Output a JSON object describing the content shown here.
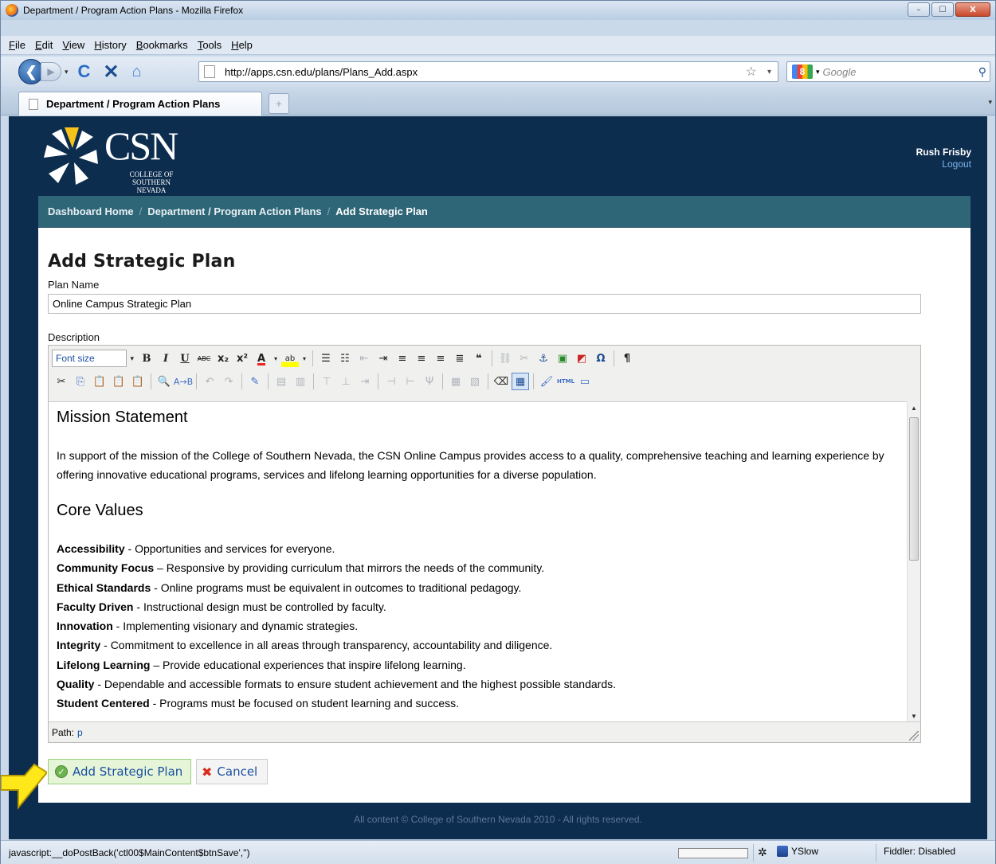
{
  "window": {
    "title": "Department / Program Action Plans - Mozilla Firefox",
    "minimize": "–",
    "maximize": "☐",
    "close": "X"
  },
  "menu": [
    {
      "label": "File"
    },
    {
      "label": "Edit"
    },
    {
      "label": "View"
    },
    {
      "label": "History"
    },
    {
      "label": "Bookmarks"
    },
    {
      "label": "Tools"
    },
    {
      "label": "Help"
    }
  ],
  "nav": {
    "url": "http://apps.csn.edu/plans/Plans_Add.aspx",
    "search_placeholder": "Google"
  },
  "tab": {
    "title": "Department / Program Action Plans"
  },
  "header": {
    "logo_text": "CSN",
    "logo_sub": "COLLEGE OF SOUTHERN NEVADA",
    "user_name": "Rush Frisby",
    "logout": "Logout"
  },
  "breadcrumb": {
    "items": [
      "Dashboard Home",
      "Department / Program Action Plans"
    ],
    "current": "Add Strategic Plan"
  },
  "form": {
    "page_title": "Add Strategic Plan",
    "plan_name_label": "Plan Name",
    "plan_name_value": "Online Campus Strategic Plan",
    "description_label": "Description",
    "font_size_label": "Font size"
  },
  "content": {
    "mission_heading": "Mission Statement",
    "mission_text": "In support of the mission of the College of Southern Nevada, the CSN Online Campus provides access to a quality, comprehensive teaching and learning experience by offering innovative educational programs, services and lifelong learning opportunities for a diverse population.",
    "values_heading": "Core Values",
    "values": [
      {
        "term": "Accessibility",
        "sep": " - ",
        "text": "Opportunities and services for everyone."
      },
      {
        "term": "Community Focus",
        "sep": " – ",
        "text": "Responsive by providing curriculum that mirrors the needs of the community."
      },
      {
        "term": "Ethical Standards",
        "sep": " - ",
        "text": "Online programs must be equivalent in outcomes to traditional pedagogy."
      },
      {
        "term": "Faculty Driven",
        "sep": " - ",
        "text": "Instructional design must be controlled by faculty."
      },
      {
        "term": "Innovation",
        "sep": " - ",
        "text": "Implementing visionary and dynamic strategies."
      },
      {
        "term": "Integrity",
        "sep": " - ",
        "text": "Commitment to excellence in all areas through transparency, accountability and diligence."
      },
      {
        "term": "Lifelong Learning",
        "sep": " – ",
        "text": "Provide educational experiences that inspire lifelong learning."
      },
      {
        "term": "Quality",
        "sep": " - ",
        "text": "Dependable and accessible formats to ensure student achievement and the highest possible standards."
      },
      {
        "term": "Student Centered",
        "sep": " - ",
        "text": "Programs must be focused on student learning and success."
      }
    ]
  },
  "editor": {
    "path_label": "Path:",
    "path_value": "p"
  },
  "buttons": {
    "add": "Add Strategic Plan",
    "cancel": "Cancel"
  },
  "footer": "All content © College of Southern Nevada 2010 - All rights reserved.",
  "status": {
    "text": "javascript:__doPostBack('ctl00$MainContent$btnSave','')",
    "yslow": "YSlow",
    "fiddler": "Fiddler: Disabled"
  },
  "colors": {
    "page_bg": "#0d2d4f",
    "breadcrumb_bg": "#2e6678",
    "add_button_bg": "#e6f5d8",
    "arrow": "#ffe81a"
  }
}
